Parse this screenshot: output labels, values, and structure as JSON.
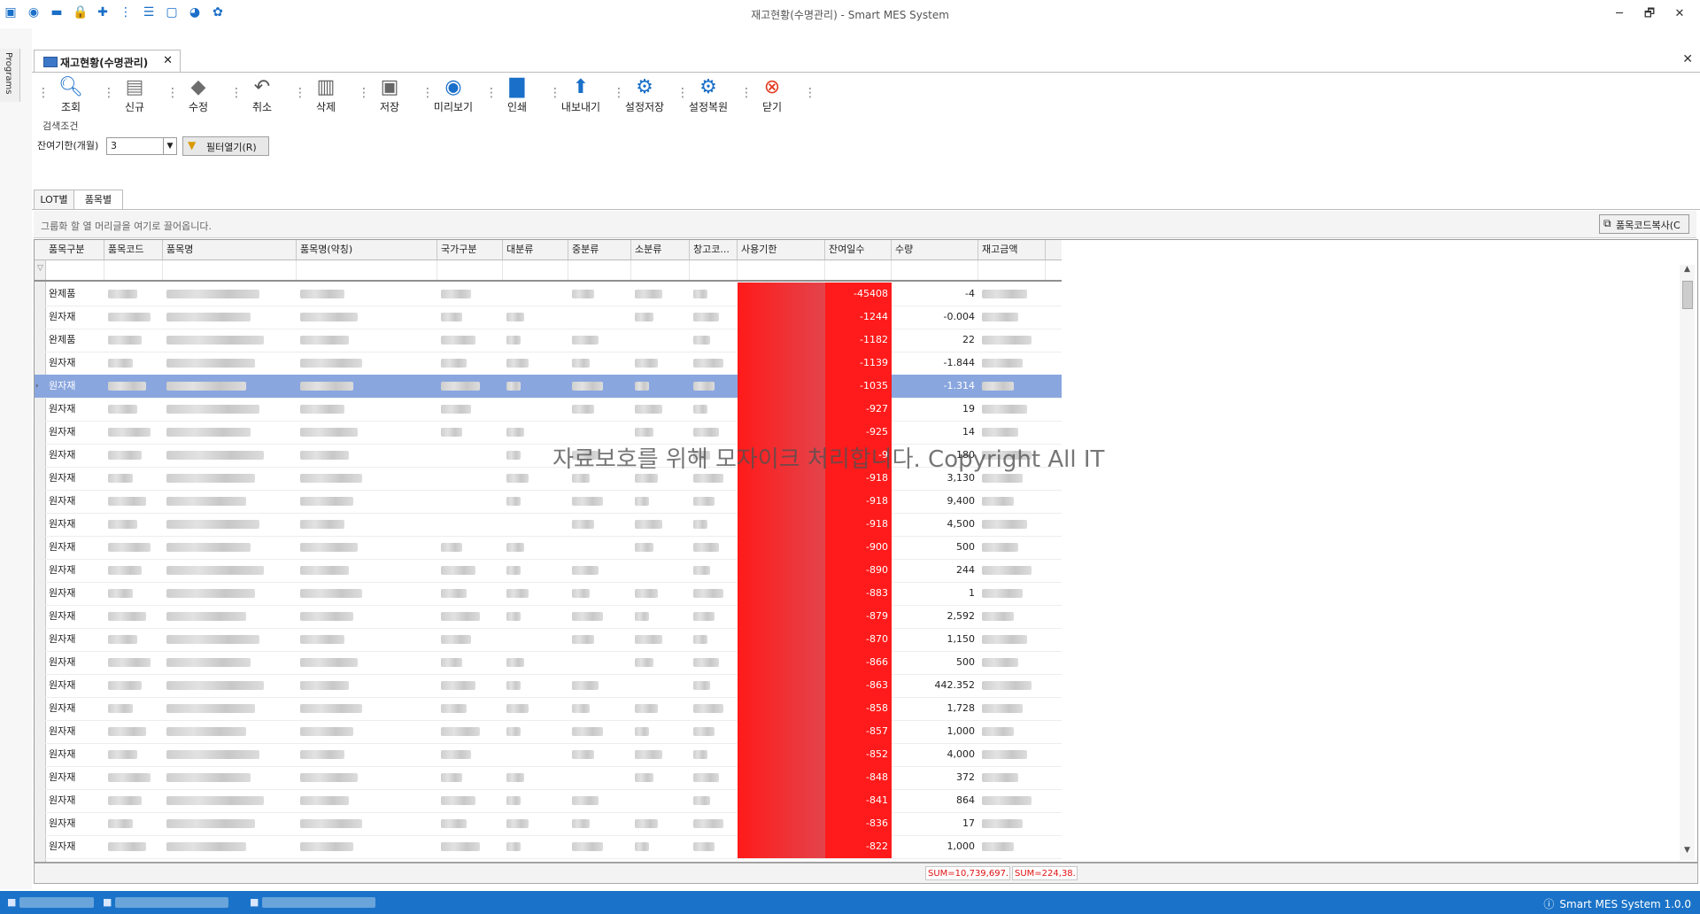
{
  "window": {
    "title": "재고현황(수명관리) - Smart MES System",
    "controls": {
      "minimize": "─",
      "restore": "🗗",
      "close": "✕"
    }
  },
  "quick_access_icons": [
    "app-icon",
    "camera-icon",
    "folder-icon",
    "lock-icon",
    "add-icon",
    "hierarchy-icon",
    "list-icon",
    "window-icon",
    "palette-icon",
    "theme-icon"
  ],
  "sidebar": {
    "programs_label": "Programs"
  },
  "document_tab": {
    "label": "재고현황(수명관리)",
    "close": "✕"
  },
  "toolbar": {
    "buttons": [
      {
        "label": "조회",
        "icon": "search-icon",
        "glyph": "🔍",
        "color": "#1a6fc8"
      },
      {
        "label": "신규",
        "icon": "new-icon",
        "glyph": "📄",
        "color": "#7a7a7a"
      },
      {
        "label": "수정",
        "icon": "eraser-icon",
        "glyph": "◆",
        "color": "#6d6d6d"
      },
      {
        "label": "취소",
        "icon": "undo-icon",
        "glyph": "↶",
        "color": "#555555"
      },
      {
        "label": "삭제",
        "icon": "trash-icon",
        "glyph": "🗑",
        "color": "#666666"
      },
      {
        "label": "저장",
        "icon": "save-icon",
        "glyph": "💾",
        "color": "#666666"
      },
      {
        "label": "미리보기",
        "icon": "eye-icon",
        "glyph": "👁",
        "color": "#1a6fc8"
      },
      {
        "label": "인쇄",
        "icon": "printer-icon",
        "glyph": "🖶",
        "color": "#1a6fc8"
      },
      {
        "label": "내보내기",
        "icon": "export-icon",
        "glyph": "⬆",
        "color": "#1a6fc8"
      },
      {
        "label": "설정저장",
        "icon": "gear-save-icon",
        "glyph": "⚙",
        "color": "#1a6fc8"
      },
      {
        "label": "설정복원",
        "icon": "gear-restore-icon",
        "glyph": "⚙",
        "color": "#1a6fc8"
      },
      {
        "label": "닫기",
        "icon": "close-circle-icon",
        "glyph": "⊗",
        "color": "#e03a1e"
      }
    ]
  },
  "search": {
    "group_title": "검색조건",
    "remaining_label": "잔여기한(개월)",
    "remaining_value": "3",
    "filter_button": "필터열기(R)"
  },
  "subtabs": [
    "LOT별",
    "품목별"
  ],
  "active_subtab": "품목별",
  "grid": {
    "group_hint": "그룹화 할 열 머리글을 여기로 끌어옵니다.",
    "copy_button": "품목코드복사(C",
    "columns": [
      "품목구분",
      "품목코드",
      "품목명",
      "품목명(약칭)",
      "국가구분",
      "대분류",
      "중분류",
      "소분류",
      "창고코...",
      "사용기한",
      "잔여일수",
      "수량",
      "재고금액"
    ],
    "rows": [
      {
        "type": "완제품",
        "days": "-45408",
        "qty": "-4"
      },
      {
        "type": "원자재",
        "days": "-1244",
        "qty": "-0.004"
      },
      {
        "type": "완제품",
        "days": "-1182",
        "qty": "22"
      },
      {
        "type": "원자재",
        "days": "-1139",
        "qty": "-1.844"
      },
      {
        "type": "원자재",
        "days": "-1035",
        "qty": "-1.314"
      },
      {
        "type": "원자재",
        "days": "-927",
        "qty": "19"
      },
      {
        "type": "원자재",
        "days": "-925",
        "qty": "14"
      },
      {
        "type": "원자재",
        "days": "-9",
        "qty": "180"
      },
      {
        "type": "원자재",
        "days": "-918",
        "qty": "3,130"
      },
      {
        "type": "원자재",
        "days": "-918",
        "qty": "9,400"
      },
      {
        "type": "원자재",
        "days": "-918",
        "qty": "4,500"
      },
      {
        "type": "원자재",
        "days": "-900",
        "qty": "500"
      },
      {
        "type": "원자재",
        "days": "-890",
        "qty": "244"
      },
      {
        "type": "원자재",
        "days": "-883",
        "qty": "1"
      },
      {
        "type": "원자재",
        "days": "-879",
        "qty": "2,592"
      },
      {
        "type": "원자재",
        "days": "-870",
        "qty": "1,150"
      },
      {
        "type": "원자재",
        "days": "-866",
        "qty": "500"
      },
      {
        "type": "원자재",
        "days": "-863",
        "qty": "442.352"
      },
      {
        "type": "원자재",
        "days": "-858",
        "qty": "1,728"
      },
      {
        "type": "원자재",
        "days": "-857",
        "qty": "1,000"
      },
      {
        "type": "원자재",
        "days": "-852",
        "qty": "4,000"
      },
      {
        "type": "원자재",
        "days": "-848",
        "qty": "372"
      },
      {
        "type": "원자재",
        "days": "-841",
        "qty": "864"
      },
      {
        "type": "원자재",
        "days": "-836",
        "qty": "17"
      },
      {
        "type": "원자재",
        "days": "-822",
        "qty": "1,000"
      }
    ],
    "selected_row": 4,
    "watermark": "자료보호를 위해 모자이크 처리합니다. Copyright All IT",
    "sum_qty": "SUM=10,739,697...",
    "sum_amount": "SUM=224,38..."
  },
  "statusbar": {
    "version": "Smart MES System 1.0.0"
  },
  "colors": {
    "accent": "#1a73c8",
    "expired_red": "#ff1b1b",
    "selection": "#8aa6de"
  }
}
